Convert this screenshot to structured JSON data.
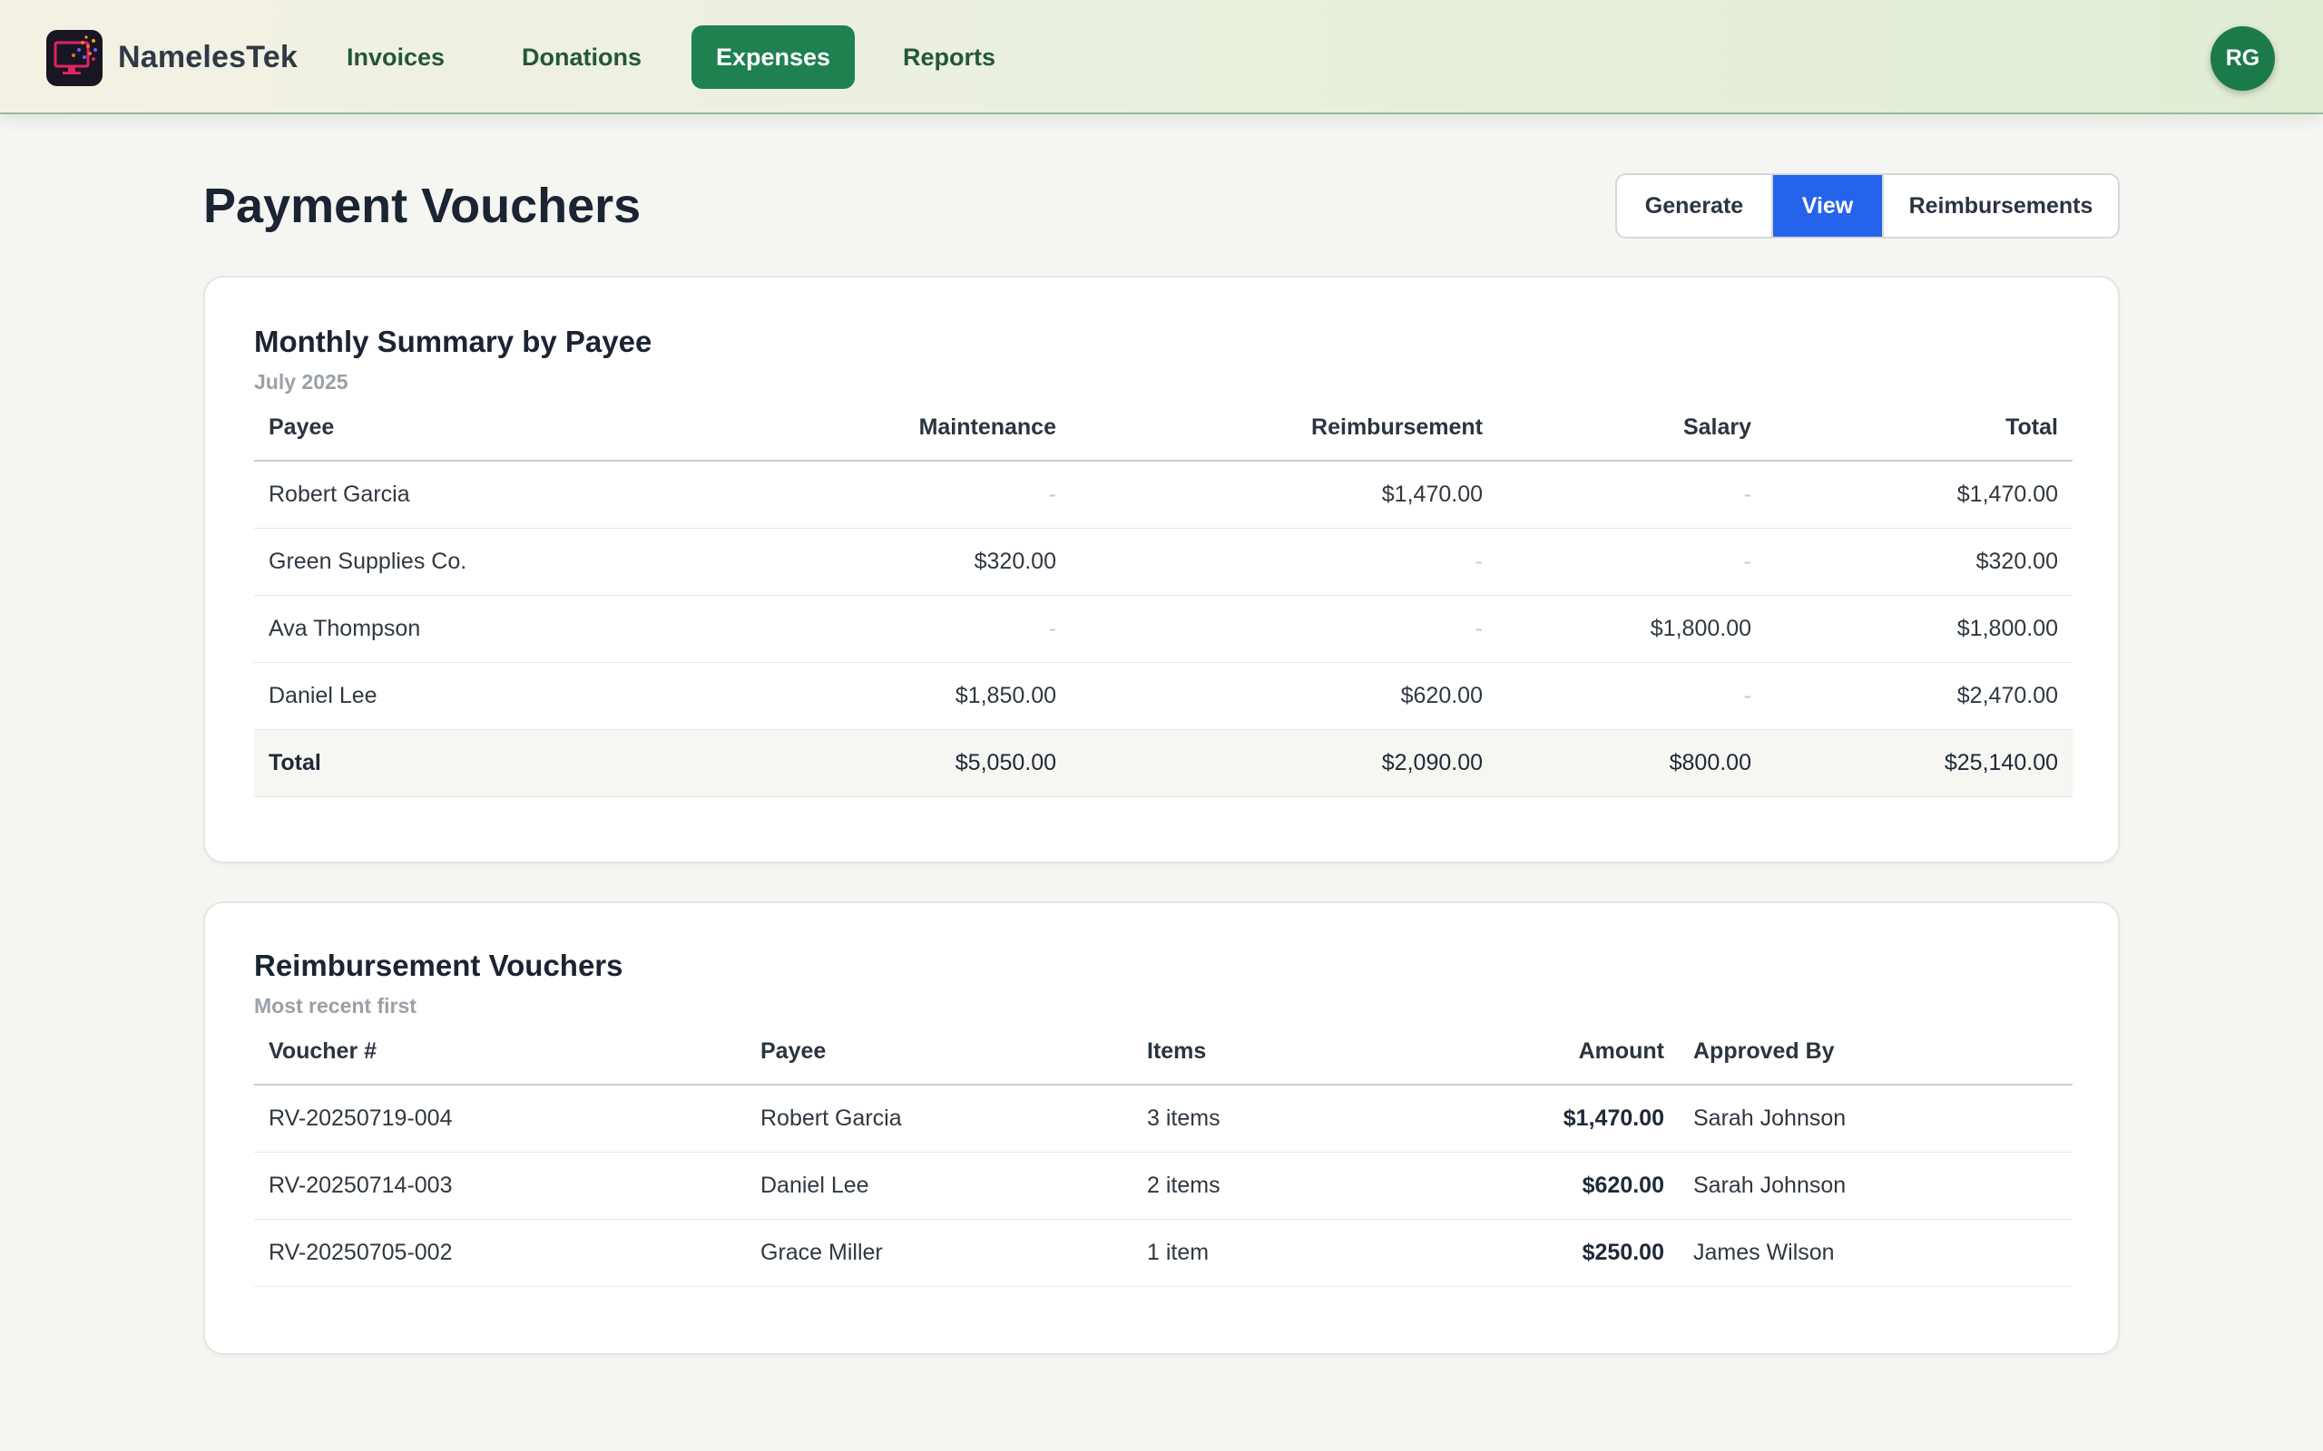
{
  "brand": {
    "name": "NamelesTek"
  },
  "nav": {
    "items": [
      {
        "label": "Invoices"
      },
      {
        "label": "Donations"
      },
      {
        "label": "Expenses"
      },
      {
        "label": "Reports"
      }
    ],
    "active": "Expenses"
  },
  "user": {
    "initials": "RG"
  },
  "page": {
    "title": "Payment Vouchers",
    "segments": [
      {
        "label": "Generate"
      },
      {
        "label": "View"
      },
      {
        "label": "Reimbursements"
      }
    ],
    "active_segment": "View"
  },
  "summary": {
    "title": "Monthly Summary by Payee",
    "subtitle": "July 2025",
    "columns": [
      "Payee",
      "Maintenance",
      "Reimbursement",
      "Salary",
      "Total"
    ],
    "rows": [
      {
        "payee": "Robert Garcia",
        "maintenance": "-",
        "reimbursement": "$1,470.00",
        "salary": "-",
        "total": "$1,470.00"
      },
      {
        "payee": "Green Supplies Co.",
        "maintenance": "$320.00",
        "reimbursement": "-",
        "salary": "-",
        "total": "$320.00"
      },
      {
        "payee": "Ava Thompson",
        "maintenance": "-",
        "reimbursement": "-",
        "salary": "$1,800.00",
        "total": "$1,800.00"
      },
      {
        "payee": "Daniel Lee",
        "maintenance": "$1,850.00",
        "reimbursement": "$620.00",
        "salary": "-",
        "total": "$2,470.00"
      }
    ],
    "total_row": {
      "label": "Total",
      "maintenance": "$5,050.00",
      "reimbursement": "$2,090.00",
      "salary": "$800.00",
      "total": "$25,140.00"
    }
  },
  "reimbursements": {
    "title": "Reimbursement Vouchers",
    "subtitle": "Most recent first",
    "columns": [
      "Voucher #",
      "Payee",
      "Items",
      "Amount",
      "Approved By"
    ],
    "rows": [
      {
        "voucher": "RV-20250719-004",
        "payee": "Robert Garcia",
        "items": "3 items",
        "amount": "$1,470.00",
        "approved_by": "Sarah Johnson"
      },
      {
        "voucher": "RV-20250714-003",
        "payee": "Daniel Lee",
        "items": "2 items",
        "amount": "$620.00",
        "approved_by": "Sarah Johnson"
      },
      {
        "voucher": "RV-20250705-002",
        "payee": "Grace Miller",
        "items": "1 item",
        "amount": "$250.00",
        "approved_by": "James Wilson"
      }
    ]
  },
  "colors": {
    "nav_active": "#1f8050",
    "segment_active": "#2563eb",
    "avatar": "#1c7a4a"
  }
}
